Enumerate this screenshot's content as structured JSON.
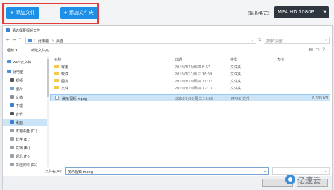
{
  "toolbar": {
    "add_file_label": "添加文件",
    "add_folder_label": "添加文件夹",
    "format_label": "输出格式：",
    "format_value": "MP4  HD 1080P",
    "accent_color": "#1d8fe6",
    "highlight_color": "#e23d3d"
  },
  "dialog": {
    "title": "请选择要视频文件",
    "address": {
      "root": "此电脑",
      "current": "桌面"
    },
    "search_placeholder": "搜索\"桌面\"",
    "organize_label": "组织 ▾",
    "new_folder_label": "新建文件夹",
    "nav_items": [
      {
        "label": "WPS云文档",
        "icon": "cloud-icon"
      },
      {
        "label": "此电脑",
        "icon": "computer-icon"
      },
      {
        "label": "视频",
        "icon": "video-icon"
      },
      {
        "label": "图片",
        "icon": "picture-icon"
      },
      {
        "label": "文档",
        "icon": "document-icon"
      },
      {
        "label": "下载",
        "icon": "download-icon"
      },
      {
        "label": "音乐",
        "icon": "music-icon"
      },
      {
        "label": "桌面",
        "icon": "desktop-icon"
      },
      {
        "label": "本地磁盘 (C:)",
        "icon": "drive-icon"
      },
      {
        "label": "软件 (D:)",
        "icon": "drive-icon"
      },
      {
        "label": "文档 (E:)",
        "icon": "drive-icon"
      },
      {
        "label": "娱乐 (F:)",
        "icon": "drive-icon"
      },
      {
        "label": "体验资料 (G:)",
        "icon": "drive-icon"
      }
    ],
    "columns": {
      "name": "名称",
      "date": "日期",
      "type": "类型",
      "size": "大小"
    },
    "files": [
      {
        "name": "常用",
        "date": "2019/3/19/周四 8:57",
        "type": "文件夹",
        "size": "",
        "kind": "folder"
      },
      {
        "name": "软件",
        "date": "2019/3/21/周三 16:59",
        "type": "文件夹",
        "size": "",
        "kind": "folder"
      },
      {
        "name": "图片",
        "date": "2019/3/19/周四 11:37",
        "type": "文件夹",
        "size": "",
        "kind": "folder"
      },
      {
        "name": "文件",
        "date": "2019/3/19/周四 12:13",
        "type": "文件夹",
        "size": "",
        "kind": "folder"
      },
      {
        "name": "演示视频.mpeg",
        "date": "2019/3/30/周三 14:56",
        "type": "MPEG 文件",
        "size": "8,685 KB",
        "kind": "file"
      }
    ],
    "filename_label": "文件名(N):",
    "filename_value": "演示视频.mpeg"
  },
  "watermark": {
    "text": "亿速云"
  }
}
